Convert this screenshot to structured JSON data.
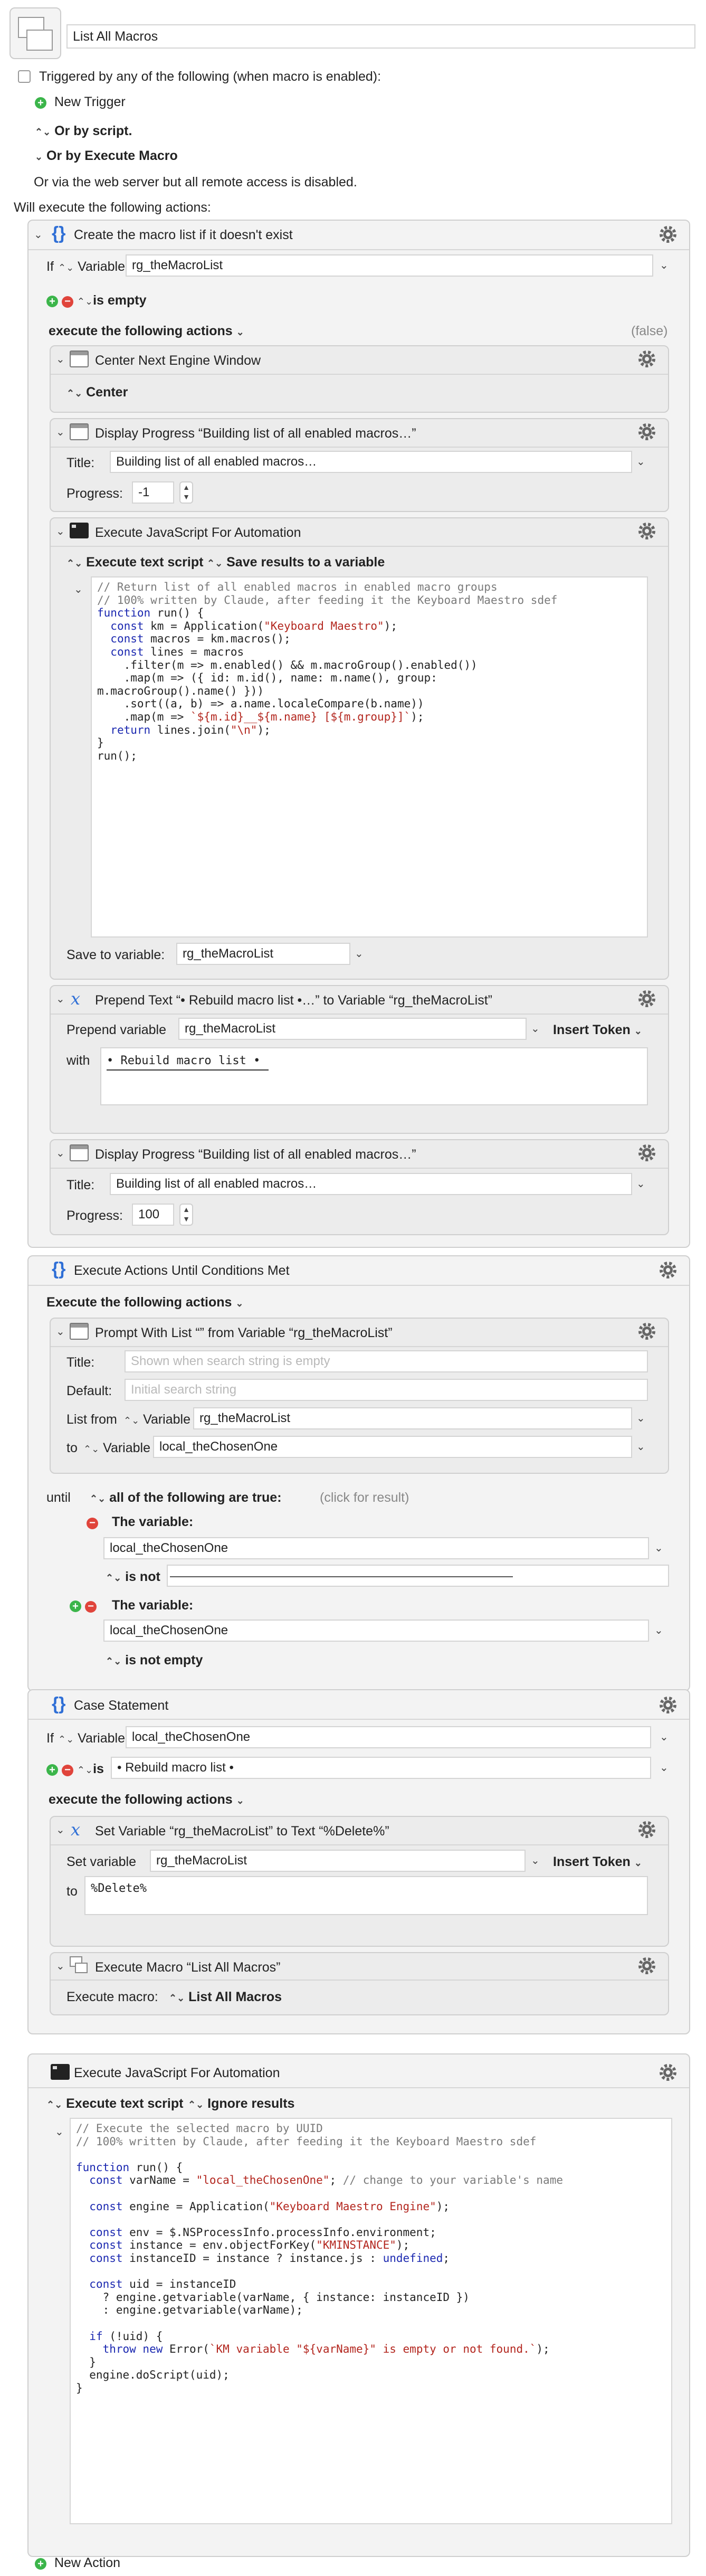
{
  "macro": {
    "name": "List All Macros"
  },
  "trigger": {
    "triggered_label": "Triggered by any of the following (when macro is enabled):",
    "new_trigger": "New Trigger",
    "or_script": "Or by script.",
    "or_execute": "Or by Execute Macro",
    "or_web": "Or via the web server but all remote access is disabled.",
    "will_execute": "Will execute the following actions:"
  },
  "a1": {
    "title": "Create the macro list if it doesn't exist",
    "if_label": "If",
    "var_word": "Variable",
    "variable": "rg_theMacroList",
    "cond": "is empty",
    "exec_label": "execute the following actions",
    "false_label": "(false)",
    "center": {
      "title": "Center Next Engine Window",
      "opt": "Center"
    },
    "prog1": {
      "title": "Display Progress “Building list of all enabled macros…”",
      "title_label": "Title:",
      "title_value": "Building list of all enabled macros…",
      "progress_label": "Progress:",
      "progress_value": "-1"
    },
    "js1": {
      "title": "Execute JavaScript For Automation",
      "opt1": "Execute text script",
      "opt2": "Save results to a variable",
      "save_label": "Save to variable:",
      "save_value": "rg_theMacroList"
    },
    "prepend": {
      "title": "Prepend Text “• Rebuild macro list •…” to Variable “rg_theMacroList”",
      "var_label": "Prepend variable",
      "var_value": "rg_theMacroList",
      "insert_token": "Insert Token",
      "with_label": "with",
      "with_value": "• Rebuild macro list •"
    },
    "prog2": {
      "title": "Display Progress “Building list of all enabled macros…”",
      "title_label": "Title:",
      "title_value": "Building list of all enabled macros…",
      "progress_label": "Progress:",
      "progress_value": "100"
    }
  },
  "a2": {
    "title": "Execute Actions Until Conditions Met",
    "exec_label": "Execute the following actions",
    "prompt": {
      "title": "Prompt With List “” from Variable “rg_theMacroList”",
      "title_label": "Title:",
      "title_ph": "Shown when search string is empty",
      "default_label": "Default:",
      "default_ph": "Initial search string",
      "list_from": "List from",
      "var_word": "Variable",
      "list_value": "rg_theMacroList",
      "to_label": "to",
      "to_value": "local_theChosenOne"
    },
    "until_label": "until",
    "all_label": "all of the following are true:",
    "click_result": "(click for result)",
    "c1": {
      "label": "The variable:",
      "value": "local_theChosenOne",
      "op": "is not"
    },
    "c2": {
      "label": "The variable:",
      "value": "local_theChosenOne",
      "op": "is not empty"
    }
  },
  "a3": {
    "title": "Case Statement",
    "if_label": "If",
    "var_word": "Variable",
    "variable": "local_theChosenOne",
    "op": "is",
    "op_value": "• Rebuild macro list •",
    "exec_label": "execute the following actions",
    "setvar": {
      "title": "Set Variable “rg_theMacroList” to Text “%Delete%”",
      "var_label": "Set variable",
      "var_value": "rg_theMacroList",
      "insert_token": "Insert Token",
      "to_label": "to",
      "to_value": "%Delete%"
    },
    "execmacro": {
      "title": "Execute Macro “List All Macros”",
      "label": "Execute macro:",
      "value": "List All Macros"
    }
  },
  "a4": {
    "title": "Execute JavaScript For Automation",
    "opt1": "Execute text script",
    "opt2": "Ignore results"
  },
  "new_action": "New Action",
  "icons": [
    "plus-icon",
    "minus-icon",
    "gear-icon",
    "curly-braces-icon",
    "window-icon",
    "terminal-icon",
    "variable-x-icon",
    "execute-macro-icon",
    "disclosure-chevron-icon",
    "stepper-icon"
  ],
  "colors": {
    "accent_blue": "#2f6fd6",
    "add_green": "#3bb54a",
    "remove_red": "#e0443b",
    "keyword_blue": "#1b28b0",
    "string_red": "#b3261e"
  }
}
